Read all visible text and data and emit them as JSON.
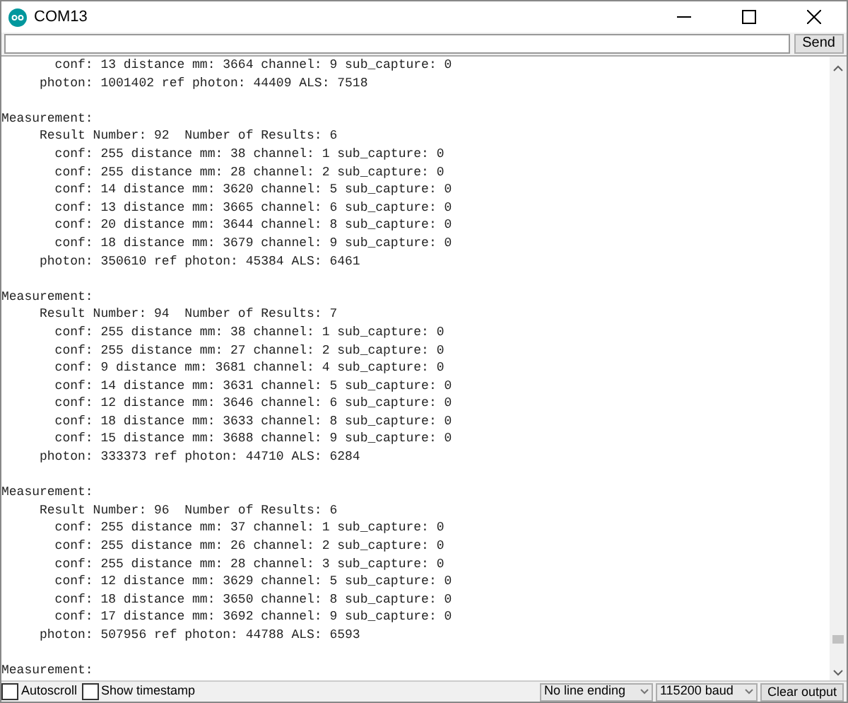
{
  "window": {
    "title": "COM13"
  },
  "send_button": "Send",
  "output": [
    {
      "targets": [
        "conf: 13 distance mm: 3664 channel: 9 sub_capture: 0"
      ],
      "photon": "photon: 1001402 ref photon: 44409 ALS: 7518"
    },
    {
      "header": "Measurement:",
      "result": "Result Number: 92  Number of Results: 6",
      "targets": [
        "conf: 255 distance mm: 38 channel: 1 sub_capture: 0",
        "conf: 255 distance mm: 28 channel: 2 sub_capture: 0",
        "conf: 14 distance mm: 3620 channel: 5 sub_capture: 0",
        "conf: 13 distance mm: 3665 channel: 6 sub_capture: 0",
        "conf: 20 distance mm: 3644 channel: 8 sub_capture: 0",
        "conf: 18 distance mm: 3679 channel: 9 sub_capture: 0"
      ],
      "photon": "photon: 350610 ref photon: 45384 ALS: 6461"
    },
    {
      "header": "Measurement:",
      "result": "Result Number: 94  Number of Results: 7",
      "targets": [
        "conf: 255 distance mm: 38 channel: 1 sub_capture: 0",
        "conf: 255 distance mm: 27 channel: 2 sub_capture: 0",
        "conf: 9 distance mm: 3681 channel: 4 sub_capture: 0",
        "conf: 14 distance mm: 3631 channel: 5 sub_capture: 0",
        "conf: 12 distance mm: 3646 channel: 6 sub_capture: 0",
        "conf: 18 distance mm: 3633 channel: 8 sub_capture: 0",
        "conf: 15 distance mm: 3688 channel: 9 sub_capture: 0"
      ],
      "photon": "photon: 333373 ref photon: 44710 ALS: 6284"
    },
    {
      "header": "Measurement:",
      "result": "Result Number: 96  Number of Results: 6",
      "targets": [
        "conf: 255 distance mm: 37 channel: 1 sub_capture: 0",
        "conf: 255 distance mm: 26 channel: 2 sub_capture: 0",
        "conf: 255 distance mm: 28 channel: 3 sub_capture: 0",
        "conf: 12 distance mm: 3629 channel: 5 sub_capture: 0",
        "conf: 18 distance mm: 3650 channel: 8 sub_capture: 0",
        "conf: 17 distance mm: 3692 channel: 9 sub_capture: 0"
      ],
      "photon": "photon: 507956 ref photon: 44788 ALS: 6593"
    },
    {
      "header": "Measurement:"
    }
  ],
  "autoscroll": {
    "label": "Autoscroll",
    "checked": false
  },
  "show_timestamp": {
    "label": "Show timestamp",
    "checked": false
  },
  "line_ending": "No line ending",
  "baud": "115200 baud",
  "clear_button": "Clear output"
}
